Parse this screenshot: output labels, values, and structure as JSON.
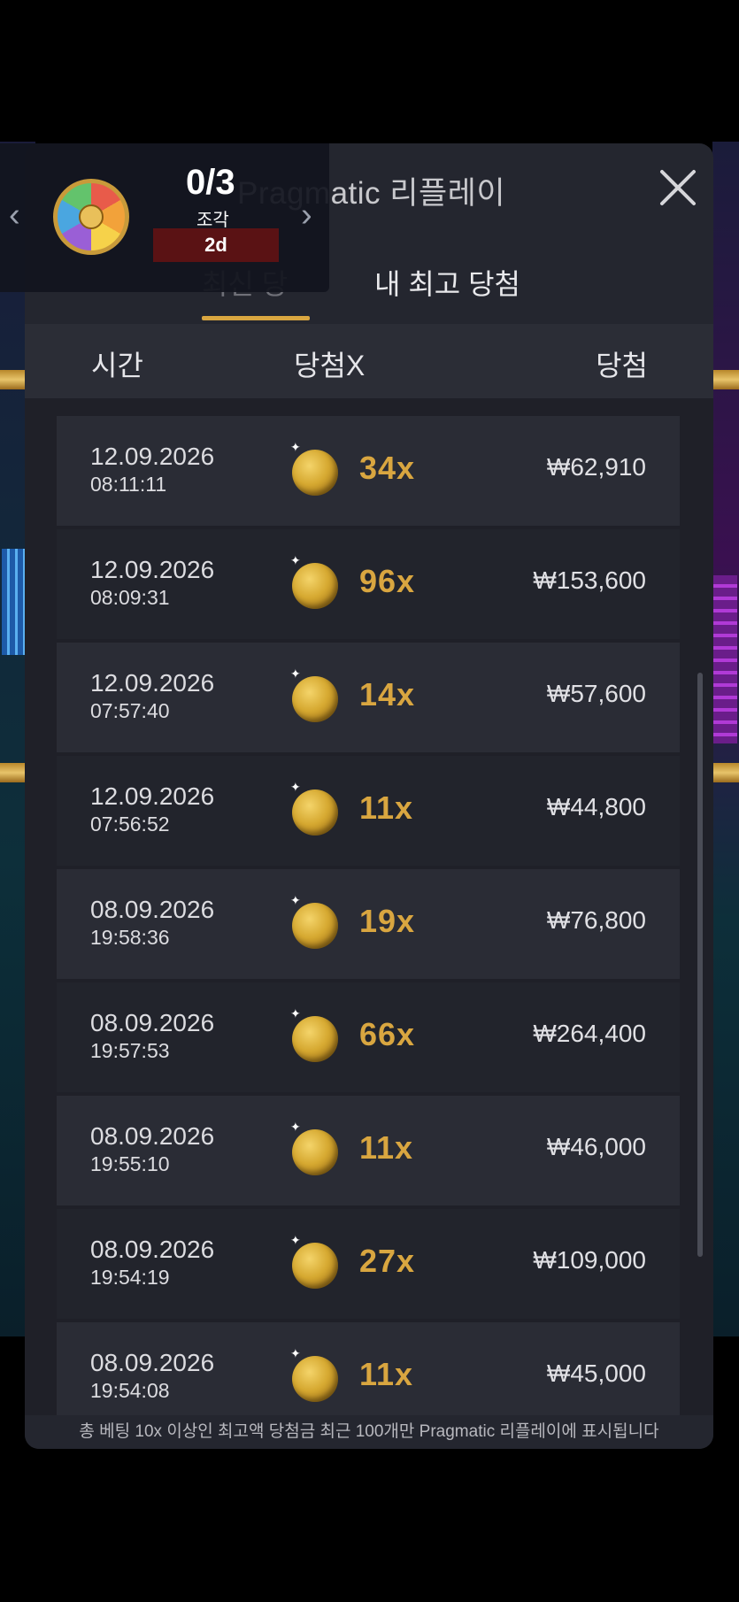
{
  "panel": {
    "title": "Pragmatic 리플레이"
  },
  "tabs": [
    {
      "label": "최신 당",
      "active": true
    },
    {
      "label": "내 최고 당첨",
      "active": false
    }
  ],
  "columns": {
    "time": "시간",
    "multiplier": "당첨X",
    "win": "당첨"
  },
  "rows": [
    {
      "date": "12.09.2026",
      "time": "08:11:11",
      "multiplier": "34x",
      "win": "₩62,910"
    },
    {
      "date": "12.09.2026",
      "time": "08:09:31",
      "multiplier": "96x",
      "win": "₩153,600"
    },
    {
      "date": "12.09.2026",
      "time": "07:57:40",
      "multiplier": "14x",
      "win": "₩57,600"
    },
    {
      "date": "12.09.2026",
      "time": "07:56:52",
      "multiplier": "11x",
      "win": "₩44,800"
    },
    {
      "date": "08.09.2026",
      "time": "19:58:36",
      "multiplier": "19x",
      "win": "₩76,800"
    },
    {
      "date": "08.09.2026",
      "time": "19:57:53",
      "multiplier": "66x",
      "win": "₩264,400"
    },
    {
      "date": "08.09.2026",
      "time": "19:55:10",
      "multiplier": "11x",
      "win": "₩46,000"
    },
    {
      "date": "08.09.2026",
      "time": "19:54:19",
      "multiplier": "27x",
      "win": "₩109,000"
    },
    {
      "date": "08.09.2026",
      "time": "19:54:08",
      "multiplier": "11x",
      "win": "₩45,000"
    }
  ],
  "footer": {
    "note": "총 베팅 10x 이상인 최고액 당첨금 최근 100개만 Pragmatic 리플레이에 표시됩니다"
  },
  "fragment_widget": {
    "count": "0/3",
    "label": "조각",
    "timer": "2d"
  },
  "colors": {
    "accent_gold": "#d9a640",
    "panel_bg": "#24262f",
    "timer_bg": "#5a1214"
  },
  "icons": {
    "close": "close-icon",
    "coin": "coin-icon",
    "wheel": "wheel-icon",
    "prev": "chevron-left-icon",
    "next": "chevron-right-icon"
  }
}
